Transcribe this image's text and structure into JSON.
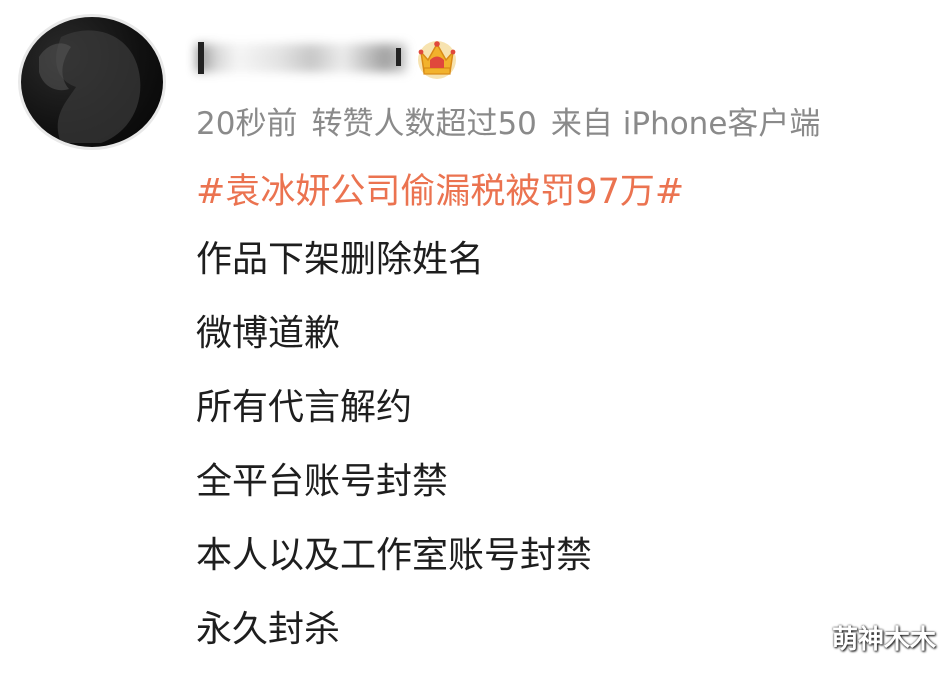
{
  "post": {
    "meta": {
      "time": "20秒前",
      "reposts": "转赞人数超过50",
      "source": "来自 iPhone客户端"
    },
    "topic": "#袁冰妍公司偷漏税被罚97万#",
    "lines": [
      "作品下架删除姓名",
      "微博道歉",
      "所有代言解约",
      "全平台账号封禁",
      "本人以及工作室账号封禁",
      "永久封杀"
    ]
  },
  "watermark": "萌神木木",
  "colors": {
    "topic": "#eb7350",
    "meta": "#8a8a8a",
    "body_text": "#1e1e1e",
    "crown_gold": "#f2b22c",
    "crown_red": "#e0483c"
  }
}
